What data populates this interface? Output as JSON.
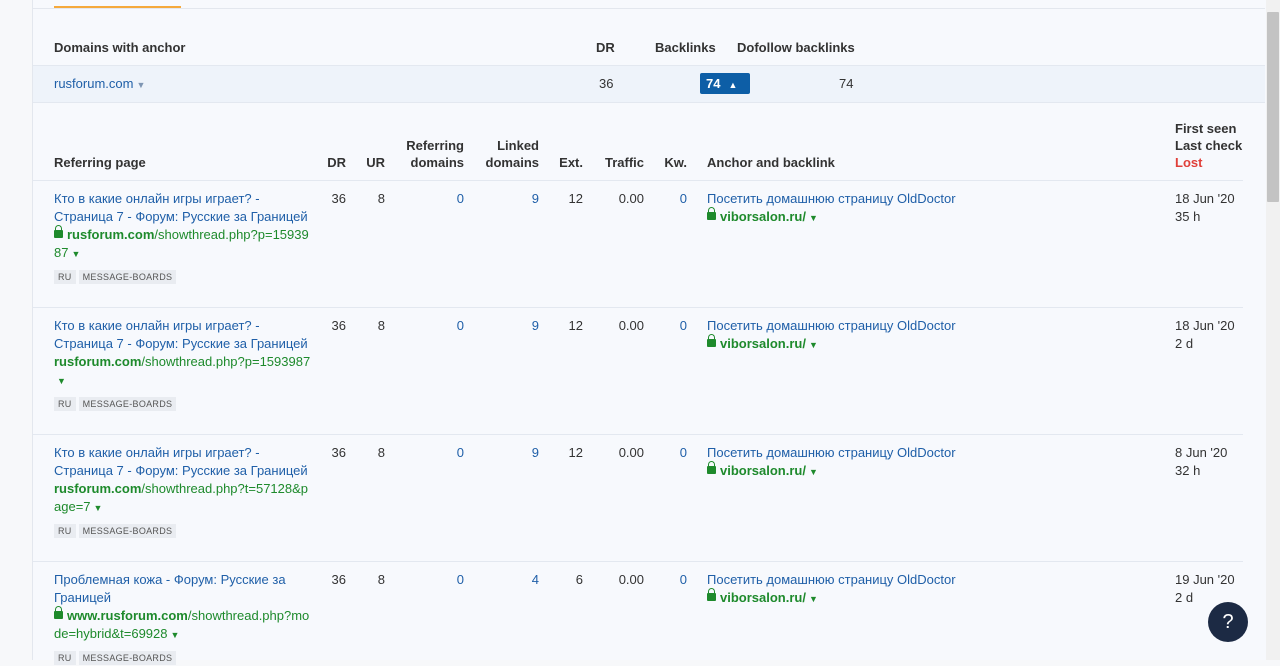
{
  "summary": {
    "headers": {
      "domains_with_anchor": "Domains with anchor",
      "dr": "DR",
      "backlinks": "Backlinks",
      "dofollow": "Dofollow backlinks"
    },
    "row": {
      "domain": "rusforum.com",
      "dr": "36",
      "backlinks": "74",
      "dofollow": "74"
    }
  },
  "table": {
    "headers": {
      "referring_page": "Referring page",
      "dr": "DR",
      "ur": "UR",
      "referring_domains_1": "Referring",
      "referring_domains_2": "domains",
      "linked_domains_1": "Linked",
      "linked_domains_2": "domains",
      "ext": "Ext.",
      "traffic": "Traffic",
      "kw": "Kw.",
      "anchor": "Anchor and backlink",
      "first_seen": "First seen",
      "last_check": "Last check",
      "lost": "Lost"
    },
    "rows": [
      {
        "title": "Кто в какие онлайн игры играет? - Страница 7 - Форум: Русские за Границей",
        "url_domain": "rusforum.com",
        "url_path": "/showthread.php?p=1593987",
        "secure": true,
        "tags": [
          "RU",
          "MESSAGE-BOARDS"
        ],
        "dr": "36",
        "ur": "8",
        "ref_domains": "0",
        "linked_domains": "9",
        "ext": "12",
        "traffic": "0.00",
        "kw": "0",
        "anchor": "Посетить домашнюю страницу OldDoctor",
        "target": "viborsalon.ru/",
        "first_seen": "18 Jun '20",
        "last_check": "35 h"
      },
      {
        "title": "Кто в какие онлайн игры играет? - Страница 7 - Форум: Русские за Границей",
        "url_domain": "rusforum.com",
        "url_path": "/showthread.php?p=1593987",
        "secure": false,
        "tags": [
          "RU",
          "MESSAGE-BOARDS"
        ],
        "dr": "36",
        "ur": "8",
        "ref_domains": "0",
        "linked_domains": "9",
        "ext": "12",
        "traffic": "0.00",
        "kw": "0",
        "anchor": "Посетить домашнюю страницу OldDoctor",
        "target": "viborsalon.ru/",
        "first_seen": "18 Jun '20",
        "last_check": "2 d"
      },
      {
        "title": "Кто в какие онлайн игры играет? - Страница 7 - Форум: Русские за Границей",
        "url_domain": "rusforum.com",
        "url_path": "/showthread.php?t=57128&page=7",
        "secure": false,
        "tags": [
          "RU",
          "MESSAGE-BOARDS"
        ],
        "dr": "36",
        "ur": "8",
        "ref_domains": "0",
        "linked_domains": "9",
        "ext": "12",
        "traffic": "0.00",
        "kw": "0",
        "anchor": "Посетить домашнюю страницу OldDoctor",
        "target": "viborsalon.ru/",
        "first_seen": "8 Jun '20",
        "last_check": "32 h"
      },
      {
        "title": "Проблемная кожа - Форум: Русские за Границей",
        "url_domain": "www.rusforum.com",
        "url_path": "/showthread.php?mode=hybrid&t=69928",
        "secure": true,
        "tags": [
          "RU",
          "MESSAGE-BOARDS"
        ],
        "dr": "36",
        "ur": "8",
        "ref_domains": "0",
        "linked_domains": "4",
        "ext": "6",
        "traffic": "0.00",
        "kw": "0",
        "anchor": "Посетить домашнюю страницу OldDoctor",
        "target": "viborsalon.ru/",
        "first_seen": "19 Jun '20",
        "last_check": "2 d"
      }
    ]
  },
  "help": {
    "label": "?"
  },
  "colors": {
    "link": "#1f5fa8",
    "green": "#1e8a2c",
    "lost": "#e0403a",
    "accent": "#0d5ea6",
    "tab": "#f5a93c"
  }
}
